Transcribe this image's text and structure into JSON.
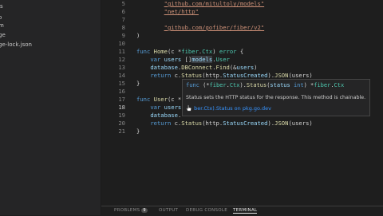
{
  "sidebar": {
    "items": [
      {
        "label": "o"
      },
      {
        "label": "ls"
      },
      {
        "label": "m"
      },
      {
        "label": "ge"
      },
      {
        "label": "ge-lock.json"
      }
    ]
  },
  "editor": {
    "lines": [
      {
        "n": "5",
        "tokens": [
          {
            "t": "        "
          },
          {
            "t": "\"github.com/mitultoly/models\"",
            "c": "str u"
          }
        ]
      },
      {
        "n": "6",
        "tokens": [
          {
            "t": "        "
          },
          {
            "t": "\"net/http\"",
            "c": "str u"
          }
        ]
      },
      {
        "n": "7",
        "tokens": []
      },
      {
        "n": "8",
        "tokens": [
          {
            "t": "        "
          },
          {
            "t": "\"github.com/gofiber/fiber/v2\"",
            "c": "str u"
          }
        ]
      },
      {
        "n": "9",
        "tokens": [
          {
            "t": ")"
          }
        ]
      },
      {
        "n": "10",
        "tokens": []
      },
      {
        "n": "11",
        "tokens": [
          {
            "t": "func ",
            "c": "kw"
          },
          {
            "t": "Home",
            "c": "fn"
          },
          {
            "t": "(c *"
          },
          {
            "t": "fiber",
            "c": "ty"
          },
          {
            "t": "."
          },
          {
            "t": "Ctx",
            "c": "ty"
          },
          {
            "t": ") "
          },
          {
            "t": "error",
            "c": "ty"
          },
          {
            "t": " {"
          }
        ]
      },
      {
        "n": "12",
        "tokens": [
          {
            "t": "    "
          },
          {
            "t": "var",
            "c": "kw"
          },
          {
            "t": " "
          },
          {
            "t": "users",
            "c": "var"
          },
          {
            "t": " []"
          },
          {
            "t": "models",
            "c": "hl"
          },
          {
            "t": "."
          },
          {
            "t": "User",
            "c": "ty"
          }
        ]
      },
      {
        "n": "13",
        "tokens": [
          {
            "t": "    "
          },
          {
            "t": "database",
            "c": "var"
          },
          {
            "t": "."
          },
          {
            "t": "DBConnect",
            "c": "fn"
          },
          {
            "t": "."
          },
          {
            "t": "Find",
            "c": "fn"
          },
          {
            "t": "(&"
          },
          {
            "t": "users",
            "c": "var"
          },
          {
            "t": ")"
          }
        ]
      },
      {
        "n": "14",
        "tokens": [
          {
            "t": "    "
          },
          {
            "t": "return",
            "c": "kw"
          },
          {
            "t": " c."
          },
          {
            "t": "Status",
            "c": "fn"
          },
          {
            "t": "(http."
          },
          {
            "t": "StatusCreated",
            "c": "var"
          },
          {
            "t": ")."
          },
          {
            "t": "JSON",
            "c": "fn"
          },
          {
            "t": "(users)"
          }
        ]
      },
      {
        "n": "15",
        "tokens": [
          {
            "t": "}"
          }
        ]
      },
      {
        "n": "16",
        "tokens": []
      },
      {
        "n": "17",
        "tokens": [
          {
            "t": "func ",
            "c": "kw"
          },
          {
            "t": "User",
            "c": "fn"
          },
          {
            "t": "(c *"
          }
        ]
      },
      {
        "n": "18",
        "tokens": [
          {
            "t": "    "
          },
          {
            "t": "var",
            "c": "kw"
          },
          {
            "t": " "
          },
          {
            "t": "users",
            "c": "var"
          }
        ],
        "current": true
      },
      {
        "n": "19",
        "tokens": [
          {
            "t": "    "
          },
          {
            "t": "database",
            "c": "var"
          },
          {
            "t": "."
          }
        ]
      },
      {
        "n": "20",
        "tokens": [
          {
            "t": "    "
          },
          {
            "t": "return",
            "c": "kw"
          },
          {
            "t": " c."
          },
          {
            "t": "Status",
            "c": "fn"
          },
          {
            "t": "(http."
          },
          {
            "t": "StatusCreated",
            "c": "var"
          },
          {
            "t": ")."
          },
          {
            "t": "JSON",
            "c": "fn"
          },
          {
            "t": "(users)"
          }
        ]
      },
      {
        "n": "21",
        "tokens": [
          {
            "t": "}"
          }
        ]
      }
    ]
  },
  "hover": {
    "signature": [
      {
        "t": "func",
        "c": "kw"
      },
      {
        "t": " (*"
      },
      {
        "t": "fiber",
        "c": "ty"
      },
      {
        "t": "."
      },
      {
        "t": "Ctx",
        "c": "ty"
      },
      {
        "t": ")."
      },
      {
        "t": "Status",
        "c": "fn"
      },
      {
        "t": "("
      },
      {
        "t": "status",
        "c": "var"
      },
      {
        "t": " "
      },
      {
        "t": "int",
        "c": "kw"
      },
      {
        "t": ") *"
      },
      {
        "t": "fiber",
        "c": "ty"
      },
      {
        "t": "."
      },
      {
        "t": "Ctx",
        "c": "ty"
      }
    ],
    "description": "Status sets the HTTP status for the response. This method is chainable.",
    "link": "ber.Ctx).Status on pkg.go.dev"
  },
  "panel": {
    "tabs": [
      {
        "label": "PROBLEMS"
      },
      {
        "label": "OUTPUT"
      },
      {
        "label": "DEBUG CONSOLE"
      },
      {
        "label": "TERMINAL"
      }
    ],
    "problems_count": "9"
  }
}
